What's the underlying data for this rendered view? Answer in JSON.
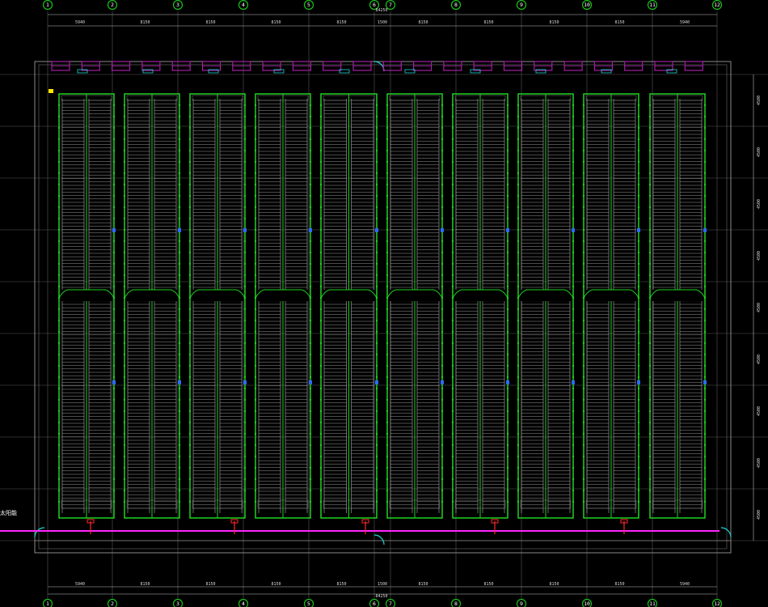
{
  "grid": {
    "axis_labels": [
      "1",
      "2",
      "3",
      "4",
      "5",
      "6",
      "7",
      "8",
      "9",
      "10",
      "11",
      "12"
    ],
    "top_spacings": [
      "5940",
      "8150",
      "8150",
      "8150",
      "8150",
      "1500",
      "8150",
      "8150",
      "8150",
      "8150",
      "5940"
    ],
    "bottom_spacings": [
      "5940",
      "8150",
      "8150",
      "8150",
      "8150",
      "1500",
      "8150",
      "8150",
      "8150",
      "8150",
      "5940"
    ],
    "total_top": "84250",
    "total_bottom": "84250",
    "right_spacings": [
      "4500",
      "4500",
      "4500",
      "4500",
      "4500",
      "4500",
      "4500",
      "4500",
      "4500"
    ]
  },
  "notes": {
    "left_edge": "太阳能",
    "aisle_label": "太阳能"
  },
  "colors": {
    "background": "#000000",
    "grid": "#5a5a5a",
    "axis_bubble": "#19c419",
    "rack_outline": "#1fd21f",
    "panel_line": "#aaaaaa",
    "purple_units": "#b21fb2",
    "magenta_cable": "#ff26ff",
    "cyan": "#1fd2d2",
    "red": "#ff2a2a",
    "blue": "#2a6bff",
    "yellow": "#ffe600"
  }
}
